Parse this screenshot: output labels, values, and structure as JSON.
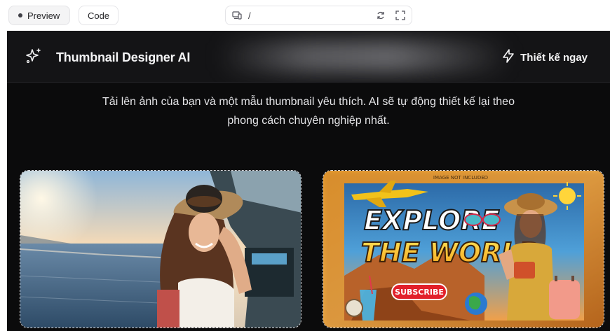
{
  "toolbar": {
    "preview_label": "Preview",
    "code_label": "Code",
    "url_path": "/",
    "icons": [
      "device-icon",
      "refresh-icon",
      "fullscreen-icon"
    ]
  },
  "app": {
    "title": "Thumbnail Designer AI",
    "cta_label": "Thiết kế ngay",
    "intro_line1": "Tải lên ảnh của bạn và một mẫu thumbnail yêu thích. AI sẽ tự động thiết kế lại theo",
    "intro_line2": "phong cách chuyên nghiệp nhất.",
    "colors": {
      "background": "#0b0b0c",
      "header": "#141416",
      "text": "#f4f4f5"
    }
  },
  "template_card": {
    "note": "IMAGE NOT INCLUDED",
    "line1": "EXPLORE",
    "line2": "THE WORLD",
    "subscribe": "SUBSCRIBE"
  }
}
